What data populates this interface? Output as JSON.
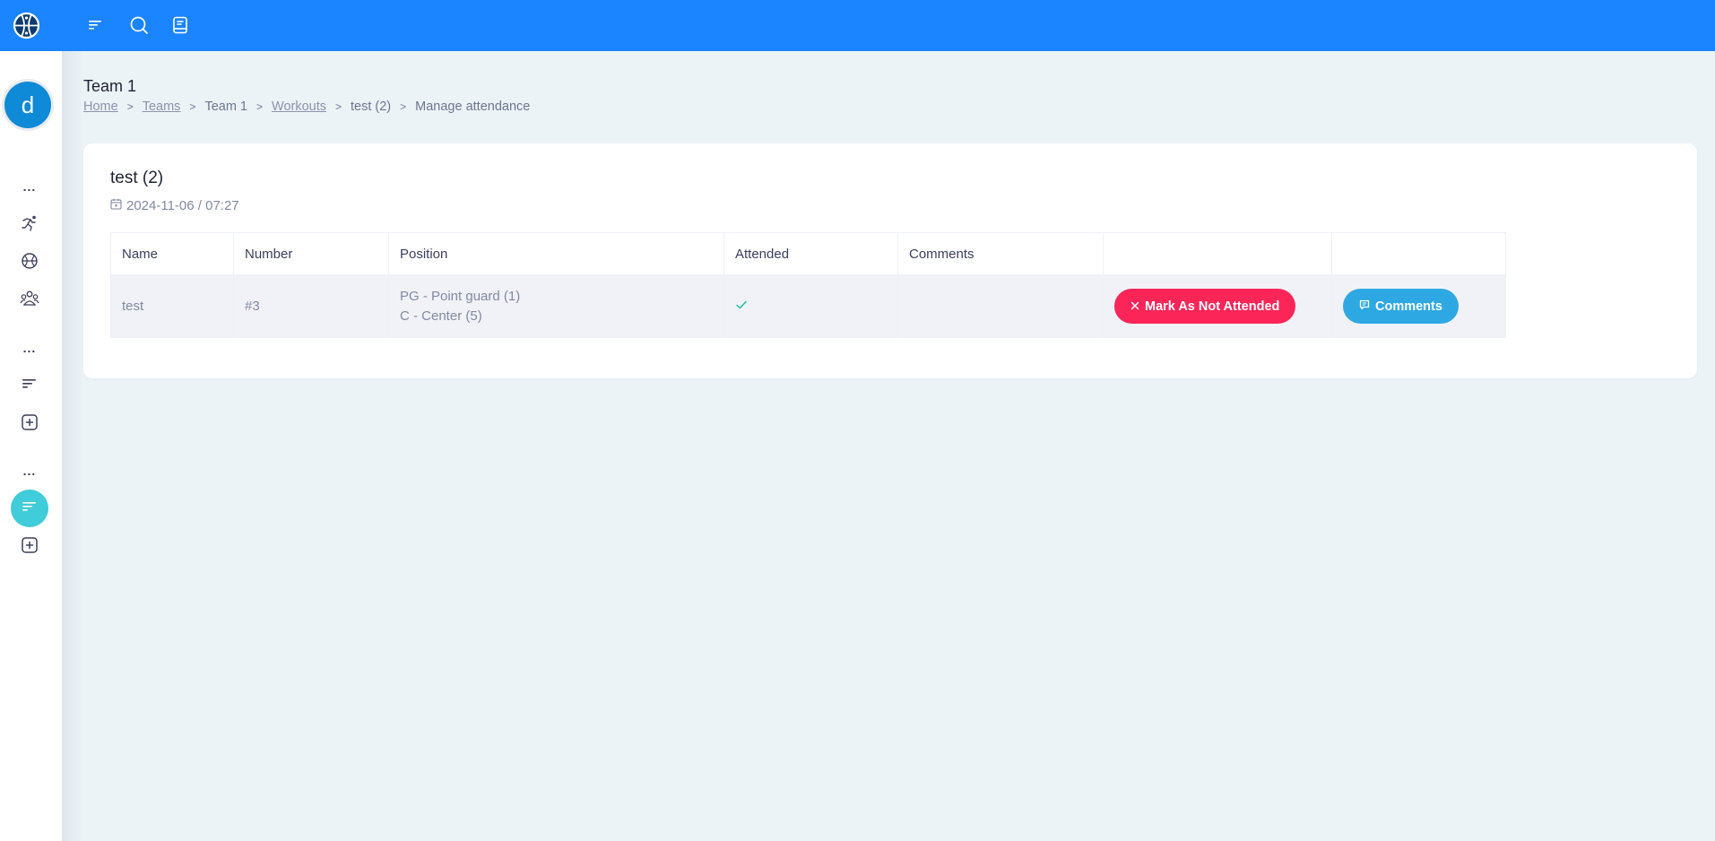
{
  "topbar": {
    "icons": [
      "basketball-logo-icon",
      "menu-icon",
      "search-icon",
      "book-icon"
    ]
  },
  "sidebar": {
    "avatar_initial": "d",
    "items": [
      {
        "icon": "more-dots-icon",
        "label": "..."
      },
      {
        "icon": "running-icon"
      },
      {
        "icon": "basketball-icon"
      },
      {
        "icon": "team-icon"
      },
      {
        "icon": "more-dots-icon",
        "label": "..."
      },
      {
        "icon": "list-icon"
      },
      {
        "icon": "add-square-icon"
      },
      {
        "icon": "more-dots-icon",
        "label": "..."
      },
      {
        "icon": "list-icon",
        "active": true
      },
      {
        "icon": "add-square-icon"
      }
    ],
    "active_color": "#40ccd8"
  },
  "header": {
    "title": "Team 1",
    "breadcrumb": [
      {
        "label": "Home",
        "link": true
      },
      {
        "label": "Teams",
        "link": true
      },
      {
        "label": "Team 1",
        "link": false
      },
      {
        "label": "Workouts",
        "link": true
      },
      {
        "label": "test (2)",
        "link": false
      },
      {
        "label": "Manage attendance",
        "link": false
      }
    ]
  },
  "workout": {
    "title": "test (2)",
    "datetime": "2024-11-06 / 07:27"
  },
  "table": {
    "columns": [
      "Name",
      "Number",
      "Position",
      "Attended",
      "Comments",
      "",
      ""
    ],
    "rows": [
      {
        "name": "test",
        "number": "#3",
        "positions": [
          "PG - Point guard (1)",
          "C - Center (5)"
        ],
        "attended": true,
        "comments": "",
        "action_button": "Mark As Not Attended",
        "comments_button": "Comments"
      }
    ]
  },
  "colors": {
    "brand": "#1b84ff",
    "danger": "#fb2558",
    "info": "#2ea8e3",
    "success": "#1abc9c"
  }
}
